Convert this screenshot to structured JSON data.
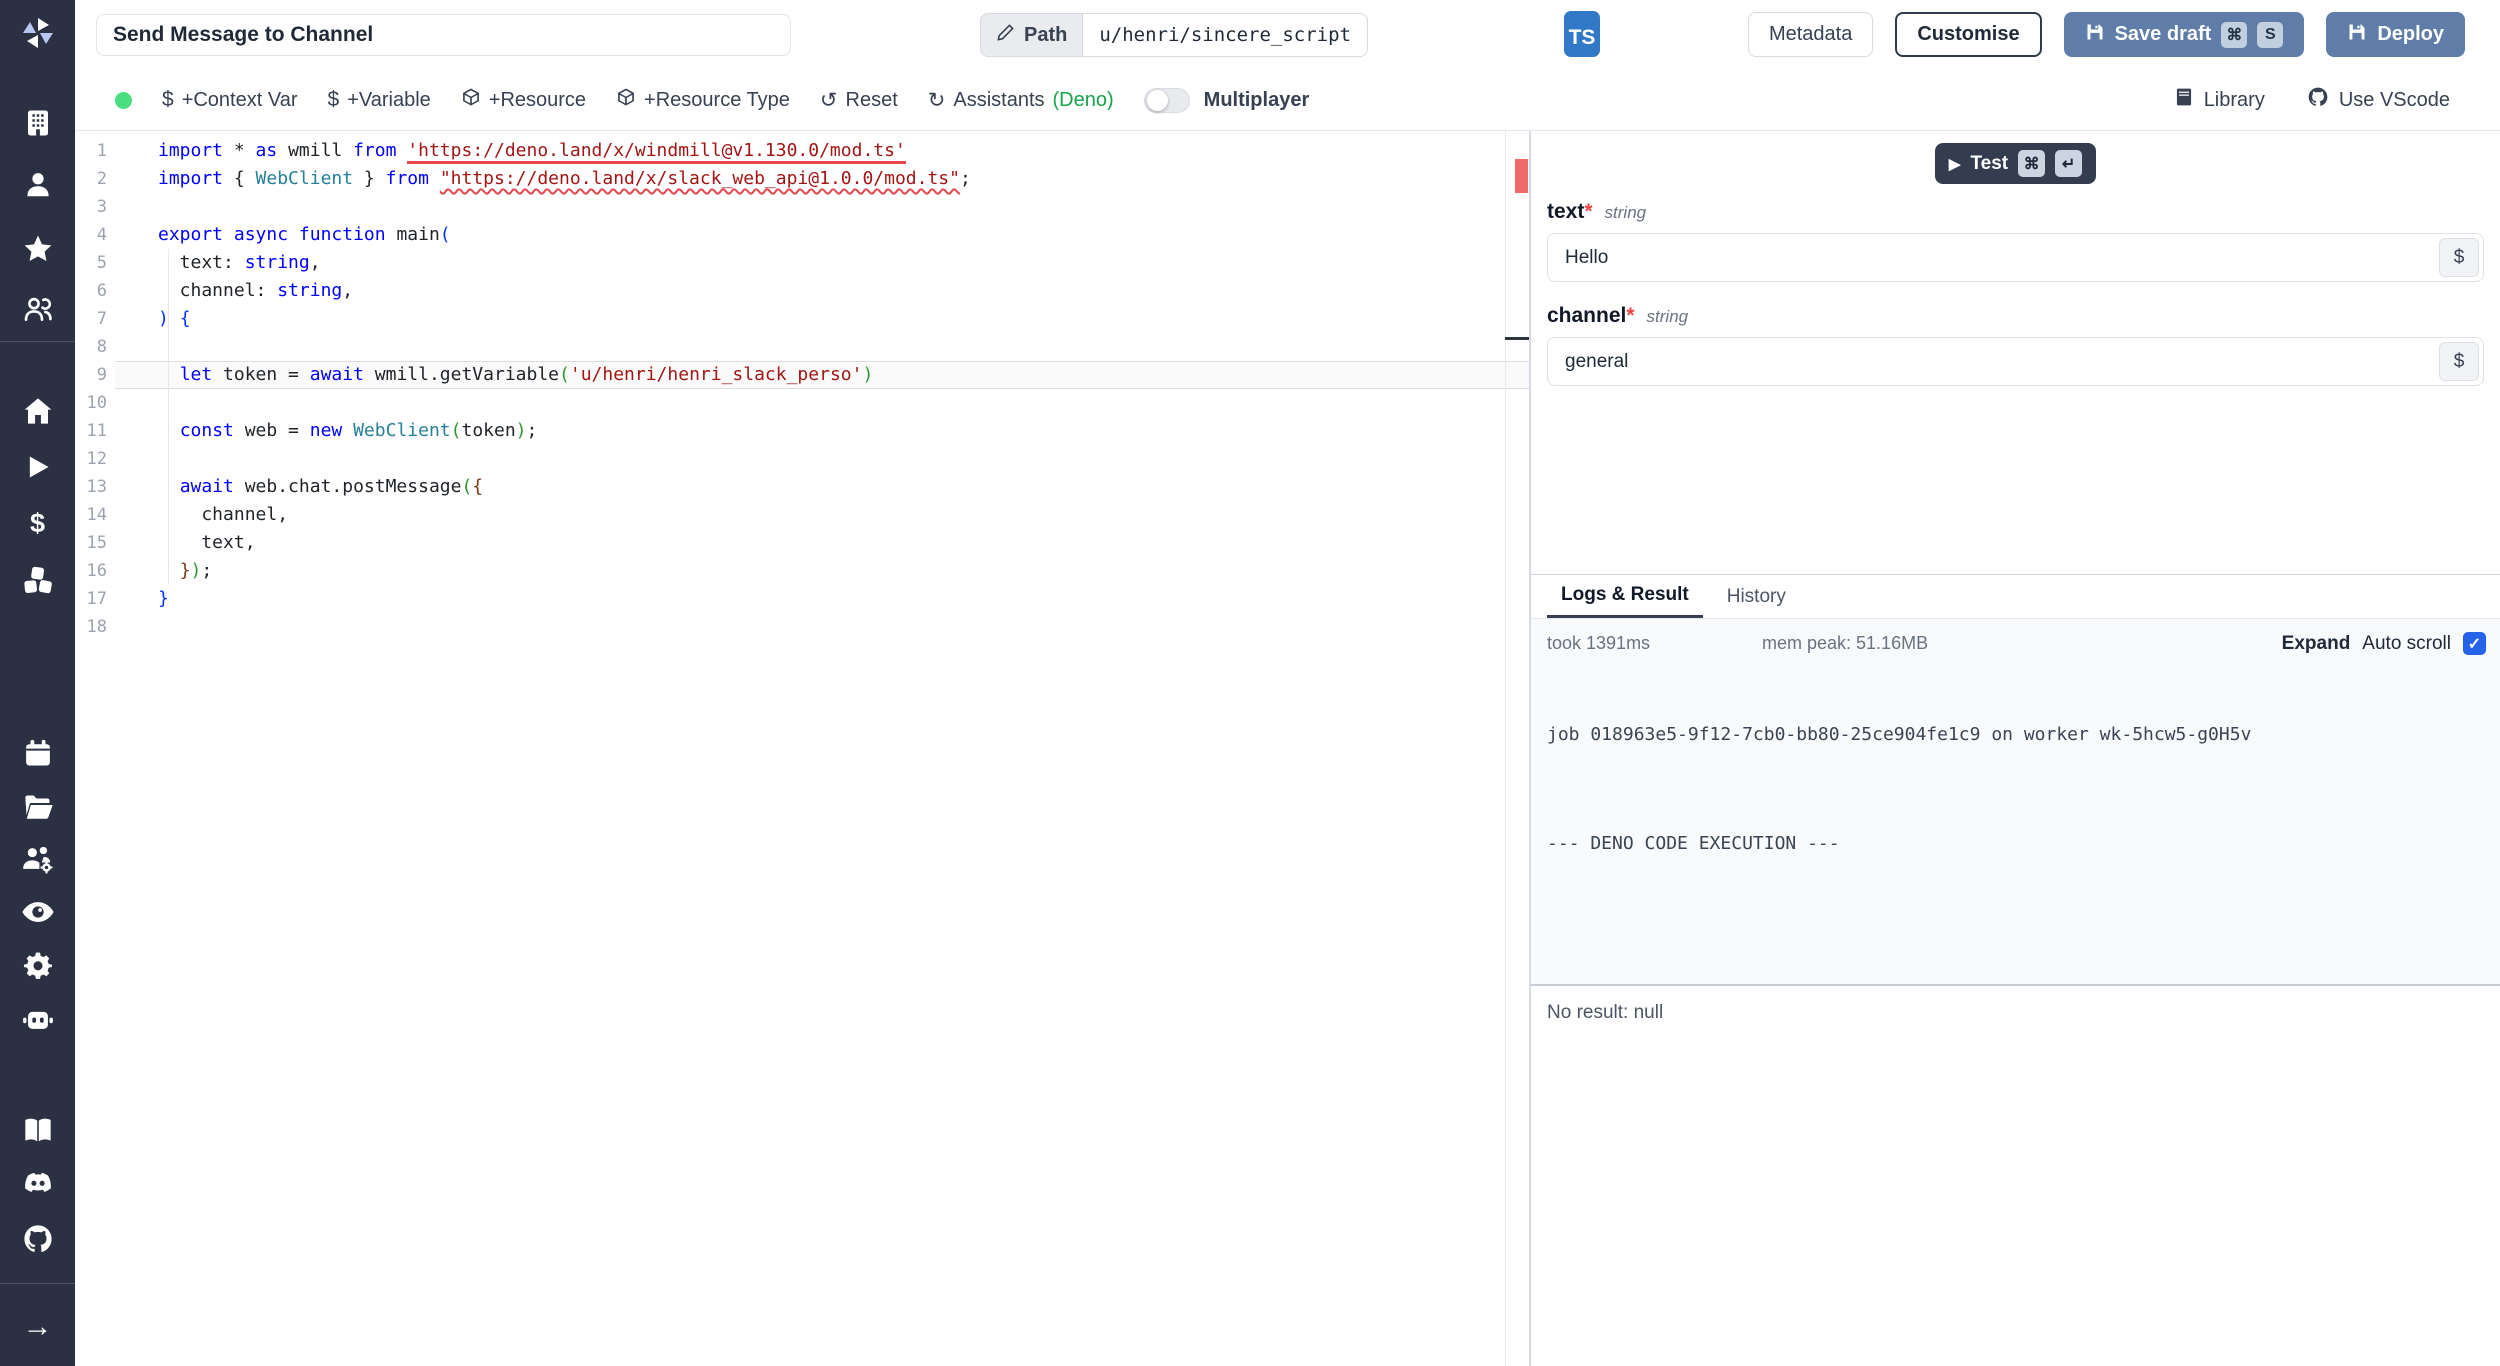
{
  "colors": {
    "sidebar_bg": "#2b3142",
    "accent_button_blue": "#5f7da8",
    "ts_badge_blue": "#3178c6",
    "deno_green": "#16a34a",
    "status_dot_green": "#4ade80",
    "checkbox_blue": "#2563eb",
    "error_red": "#e5484d"
  },
  "icons": {
    "dollar": "$",
    "reset": "↺",
    "refresh": "↻",
    "cmd": "⌘",
    "enter": "↵",
    "play": "▶",
    "check": "✓",
    "arrow_right": "→",
    "gear": "⚙"
  },
  "topbar": {
    "title_value": "Send Message to Channel",
    "path_label": "Path",
    "path_value": "u/henri/sincere_script",
    "lang_badge": "TS",
    "metadata_label": "Metadata",
    "customise_label": "Customise",
    "save_draft_label": "Save draft",
    "save_kbd1": "⌘",
    "save_kbd2": "S",
    "deploy_label": "Deploy"
  },
  "toolbar": {
    "context_var": "+Context Var",
    "variable": "+Variable",
    "resource": "+Resource",
    "resource_type": "+Resource Type",
    "reset": "Reset",
    "assistants": "Assistants",
    "assistants_lang": "(Deno)",
    "multiplayer": "Multiplayer",
    "library": "Library",
    "vscode": "Use VScode"
  },
  "editor": {
    "current_line": 9,
    "lines": [
      [
        [
          "kw",
          "import"
        ],
        [
          "pl",
          " * "
        ],
        [
          "kw",
          "as"
        ],
        [
          "pl",
          " wmill "
        ],
        [
          "kw",
          "from"
        ],
        [
          "pl",
          " "
        ],
        [
          "stru",
          "'https://deno.land/x/windmill@v1.130.0/mod.ts'"
        ]
      ],
      [
        [
          "kw",
          "import"
        ],
        [
          "pl",
          " { "
        ],
        [
          "type",
          "WebClient"
        ],
        [
          "pl",
          " } "
        ],
        [
          "kw",
          "from"
        ],
        [
          "pl",
          " "
        ],
        [
          "strw",
          "\"https://deno.land/x/slack_web_api@1.0.0/mod.ts\""
        ],
        [
          "pl",
          ";"
        ]
      ],
      [],
      [
        [
          "kw",
          "export"
        ],
        [
          "pl",
          " "
        ],
        [
          "kw",
          "async"
        ],
        [
          "pl",
          " "
        ],
        [
          "kw",
          "function"
        ],
        [
          "pl",
          " main"
        ],
        [
          "b1",
          "("
        ]
      ],
      [
        [
          "pl",
          "  text: "
        ],
        [
          "kw",
          "string"
        ],
        [
          "pl",
          ","
        ]
      ],
      [
        [
          "pl",
          "  channel: "
        ],
        [
          "kw",
          "string"
        ],
        [
          "pl",
          ","
        ]
      ],
      [
        [
          "b1",
          ")"
        ],
        [
          "pl",
          " "
        ],
        [
          "b1",
          "{"
        ]
      ],
      [],
      [
        [
          "pl",
          "  "
        ],
        [
          "kw",
          "let"
        ],
        [
          "pl",
          " token = "
        ],
        [
          "kw",
          "await"
        ],
        [
          "pl",
          " wmill.getVariable"
        ],
        [
          "b2",
          "("
        ],
        [
          "str",
          "'u/henri/henri_slack_perso'"
        ],
        [
          "b2",
          ")"
        ]
      ],
      [],
      [
        [
          "pl",
          "  "
        ],
        [
          "kw",
          "const"
        ],
        [
          "pl",
          " web = "
        ],
        [
          "kw",
          "new"
        ],
        [
          "pl",
          " "
        ],
        [
          "type",
          "WebClient"
        ],
        [
          "b2",
          "("
        ],
        [
          "pl",
          "token"
        ],
        [
          "b2",
          ")"
        ],
        [
          "pl",
          ";"
        ]
      ],
      [],
      [
        [
          "pl",
          "  "
        ],
        [
          "kw",
          "await"
        ],
        [
          "pl",
          " web.chat.postMessage"
        ],
        [
          "b2",
          "("
        ],
        [
          "b3",
          "{"
        ]
      ],
      [
        [
          "pl",
          "    channel,"
        ]
      ],
      [
        [
          "pl",
          "    text,"
        ]
      ],
      [
        [
          "pl",
          "  "
        ],
        [
          "b3",
          "}"
        ],
        [
          "b2",
          ")"
        ],
        [
          "pl",
          ";"
        ]
      ],
      [
        [
          "b1",
          "}"
        ]
      ],
      []
    ]
  },
  "form": {
    "test_label": "Test",
    "test_kbd1": "⌘",
    "test_kbd2": "↵",
    "dollar": "$",
    "fields": [
      {
        "name": "text",
        "required": "*",
        "type": "string",
        "value": "Hello"
      },
      {
        "name": "channel",
        "required": "*",
        "type": "string",
        "value": "general"
      }
    ]
  },
  "results": {
    "tab_logs": "Logs & Result",
    "tab_history": "History",
    "took": "took 1391ms",
    "mem": "mem peak: 51.16MB",
    "expand": "Expand",
    "autoscroll": "Auto scroll",
    "log_line_job": "job 018963e5-9f12-7cb0-bb80-25ce904fe1c9 on worker wk-5hcw5-g0H5v",
    "log_line_deno": "--- DENO CODE EXECUTION ---",
    "no_result": "No result: null"
  }
}
